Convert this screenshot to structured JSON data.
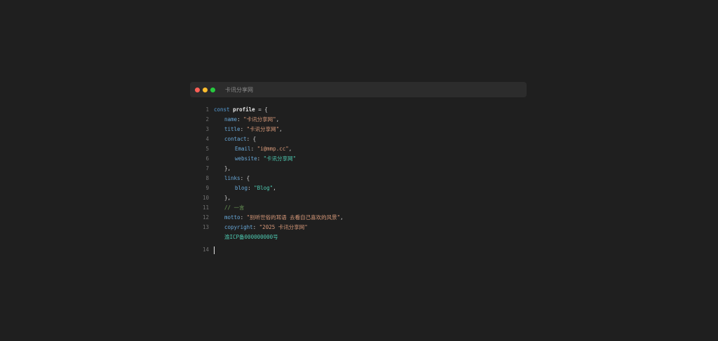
{
  "window": {
    "title": "卡讯分享网"
  },
  "code": {
    "l1": {
      "num": "1",
      "kw": "const",
      "id": "profile",
      "rest": " = {"
    },
    "l2": {
      "num": "2",
      "key": "name",
      "sep": ": ",
      "val": "\"卡讯分享网\"",
      "end": ","
    },
    "l3": {
      "num": "3",
      "key": "title",
      "sep": ": ",
      "val": "\"卡讯分享网\"",
      "end": ","
    },
    "l4": {
      "num": "4",
      "key": "contact",
      "rest": ": {"
    },
    "l5": {
      "num": "5",
      "key": "Email",
      "sep": ": ",
      "val": "\"i@mmp.cc\"",
      "end": ","
    },
    "l6": {
      "num": "6",
      "key": "website",
      "sep": ": ",
      "val": "\"卡讯分享网\""
    },
    "l7": {
      "num": "7",
      "text": "},"
    },
    "l8": {
      "num": "8",
      "key": "links",
      "rest": ": {"
    },
    "l9": {
      "num": "9",
      "key": "blog",
      "sep": ": ",
      "val": "\"Blog\"",
      "end": ","
    },
    "l10": {
      "num": "10",
      "text": "},"
    },
    "l11": {
      "num": "11",
      "comment": "// 一言"
    },
    "l12": {
      "num": "12",
      "key": "motto",
      "sep": ": ",
      "val": "\"别听世俗的耳语 去看自己喜欢的风景\"",
      "end": ","
    },
    "l13": {
      "num": "13",
      "key": "copyright",
      "sep": ": ",
      "val": "\"2025 卡讯分享网\""
    },
    "icp": "渝ICP备000000000号",
    "l14": {
      "num": "14"
    }
  }
}
